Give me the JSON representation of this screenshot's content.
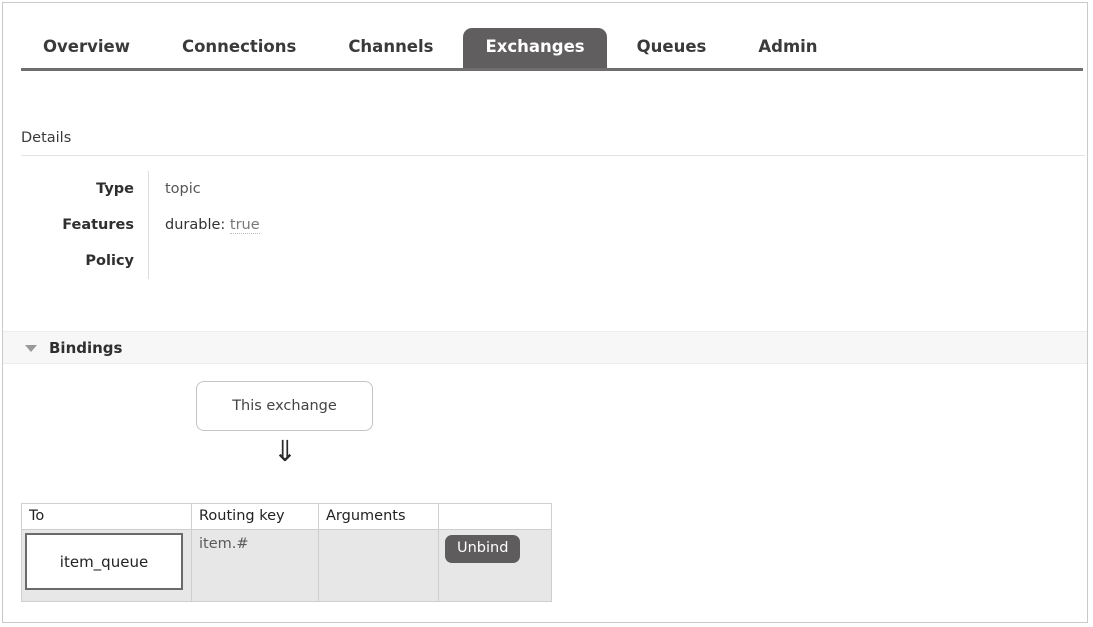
{
  "nav": {
    "tabs": [
      {
        "label": "Overview",
        "active": false
      },
      {
        "label": "Connections",
        "active": false
      },
      {
        "label": "Channels",
        "active": false
      },
      {
        "label": "Exchanges",
        "active": true
      },
      {
        "label": "Queues",
        "active": false
      },
      {
        "label": "Admin",
        "active": false
      }
    ]
  },
  "details": {
    "heading": "Details",
    "rows": [
      {
        "label": "Type",
        "value": "topic"
      },
      {
        "label": "Features",
        "value": "durable: true"
      },
      {
        "label": "Policy",
        "value": ""
      }
    ],
    "features": {
      "key": "durable:",
      "value": "true"
    }
  },
  "bindings": {
    "heading": "Bindings",
    "collapse_icon": "triangle-down-icon",
    "exchange_node_label": "This exchange",
    "arrow_glyph": "⇓",
    "table": {
      "columns": [
        "To",
        "Routing key",
        "Arguments",
        ""
      ],
      "rows": [
        {
          "to": "item_queue",
          "routing_key": "item.#",
          "arguments": "",
          "action_label": "Unbind"
        }
      ]
    }
  },
  "colors": {
    "active_tab_bg": "#605e5e",
    "tab_text": "#3a3a3a",
    "rule": "#6e6e6e",
    "section_band": "#f7f7f7",
    "table_row_bg": "#e7e7e7",
    "table_border": "#cfcfcf",
    "button_bg": "#5e5c5c",
    "frame_border": "#c9c9c9"
  }
}
